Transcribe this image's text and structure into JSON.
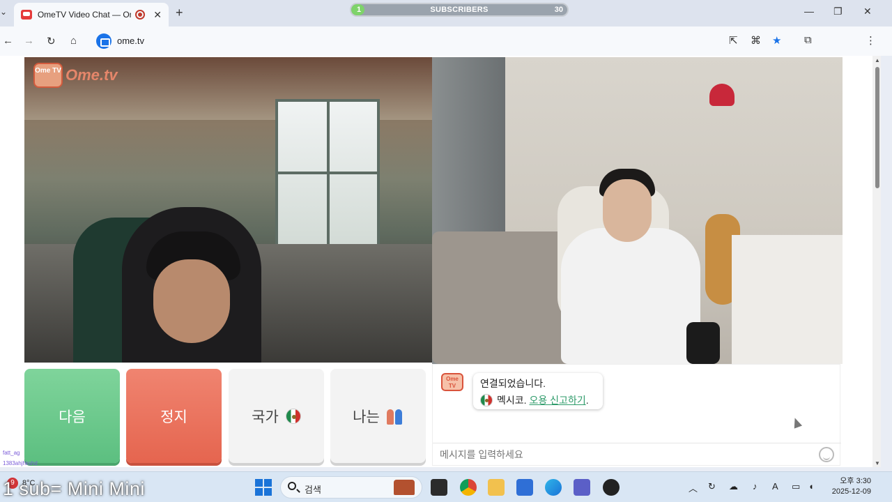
{
  "browser": {
    "tab_title": "OmeTV Video Chat — Om",
    "url": "ome.tv"
  },
  "overlay": {
    "subscribers_label": "SUBSCRIBERS",
    "subscribers_start": "1",
    "subscribers_goal": "30",
    "subscribers_progress": 0.03,
    "sub_goal_text": "1 sub= Mini Mini",
    "chat_user_1": "fatt_ag",
    "chat_user_2": "1383ahjhkshd"
  },
  "page": {
    "logo_text": "Ome.tv",
    "logo_badge": "Ome TV",
    "buttons": {
      "next": "다음",
      "stop": "정지",
      "country": "국가",
      "gender": "나는"
    },
    "chat": {
      "avatar_text": "Ome TV",
      "connected": "연결되었습니다.",
      "country_name": "멕시코.",
      "report_link": "오용 신고하기",
      "report_suffix": ".",
      "input_placeholder": "메시지를 입력하세요"
    }
  },
  "taskbar": {
    "weather_badge": "9",
    "temperature": "8°C",
    "search_label": "검색",
    "time": "오후 3:30",
    "date": "2025-12-09"
  },
  "colors": {
    "next": "#5cbf80",
    "stop": "#e5654f",
    "accent": "#1a73e8"
  }
}
